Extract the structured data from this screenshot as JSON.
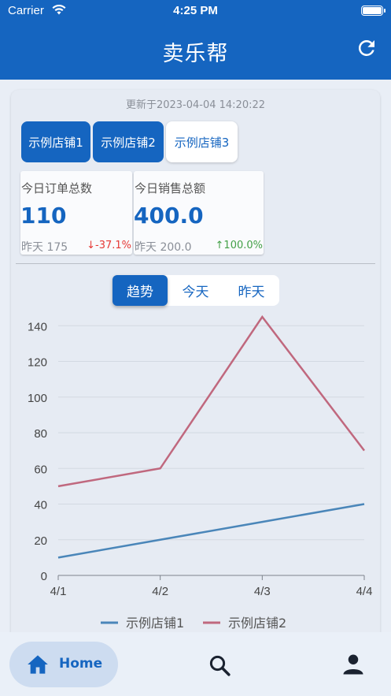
{
  "status_bar": {
    "carrier": "Carrier",
    "time": "4:25 PM"
  },
  "header": {
    "title": "卖乐帮"
  },
  "card": {
    "updated_text": "更新于2023-04-04 14:20:22",
    "shops": [
      {
        "label": "示例店铺1",
        "selected": true
      },
      {
        "label": "示例店铺2",
        "selected": true
      },
      {
        "label": "示例店铺3",
        "selected": false
      }
    ],
    "stats": [
      {
        "label": "今日订单总数",
        "value": "110",
        "prev": "昨天 175",
        "change": "↓-37.1%",
        "direction": "down"
      },
      {
        "label": "今日销售总额",
        "value": "400.0",
        "prev": "昨天 200.0",
        "change": "↑100.0%",
        "direction": "up"
      }
    ],
    "ranges": [
      {
        "label": "趋势",
        "active": true
      },
      {
        "label": "今天",
        "active": false
      },
      {
        "label": "昨天",
        "active": false
      }
    ]
  },
  "chart_data": {
    "type": "line",
    "x": [
      "4/1",
      "4/2",
      "4/3",
      "4/4"
    ],
    "yticks": [
      0,
      20,
      40,
      60,
      80,
      100,
      120,
      140
    ],
    "ylim": [
      0,
      145
    ],
    "grid": true,
    "legend_position": "bottom",
    "series": [
      {
        "name": "示例店铺1",
        "values": [
          10,
          20,
          30,
          40
        ],
        "color": "#4a86b9"
      },
      {
        "name": "示例店铺2",
        "values": [
          50,
          60,
          145,
          70
        ],
        "color": "#c0687e"
      }
    ]
  },
  "nav": {
    "home_label": "Home",
    "icons": [
      "home-icon",
      "search-icon",
      "profile-icon"
    ]
  },
  "colors": {
    "primary": "#1565c0",
    "down": "#e53935",
    "up": "#43a047"
  }
}
